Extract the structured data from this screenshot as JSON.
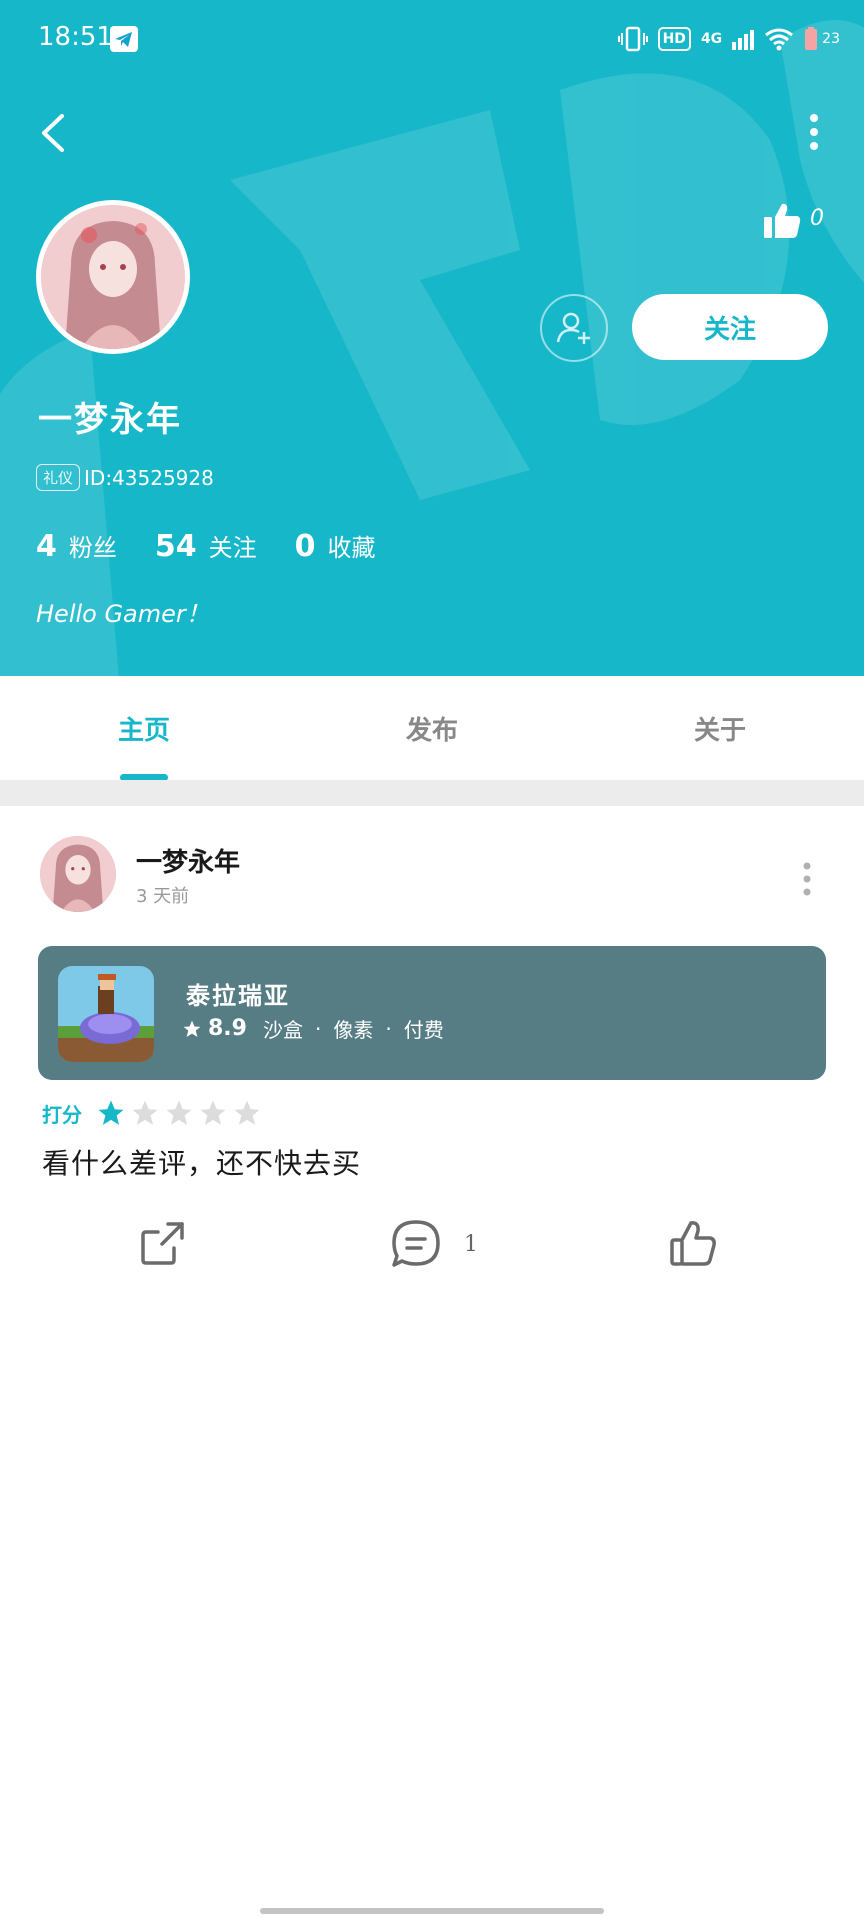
{
  "status_bar": {
    "time": "18:51",
    "hd": "HD",
    "network": "4G",
    "battery": "23"
  },
  "header": {
    "like_count": "0",
    "follow_label": "关注",
    "username": "一梦永年",
    "id_tag": "礼仪",
    "id_text": "ID:43525928",
    "stats": [
      {
        "num": "4",
        "label": "粉丝"
      },
      {
        "num": "54",
        "label": "关注"
      },
      {
        "num": "0",
        "label": "收藏"
      }
    ],
    "bio": "Hello Gamer！",
    "accent_color": "#16b7c9"
  },
  "tabs": [
    {
      "label": "主页",
      "active": true
    },
    {
      "label": "发布",
      "active": false
    },
    {
      "label": "关于",
      "active": false
    }
  ],
  "post": {
    "author": "一梦永年",
    "time": "3 天前",
    "game": {
      "name": "泰拉瑞亚",
      "score": "8.9",
      "tags": [
        "沙盒",
        "像素",
        "付费"
      ]
    },
    "rating_label": "打分",
    "rating": 1,
    "rating_max": 5,
    "text": "看什么差评，还不快去买",
    "comment_count": "1"
  }
}
